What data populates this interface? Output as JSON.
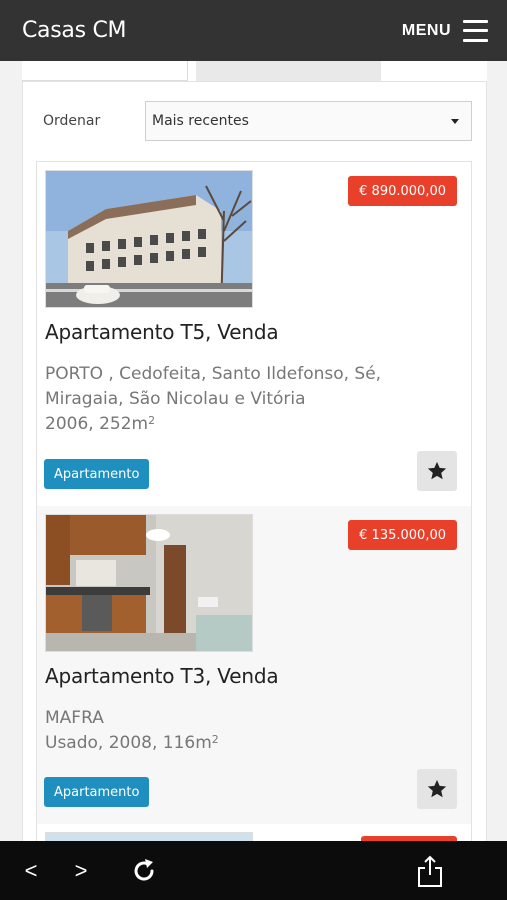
{
  "header": {
    "title": "Casas CM",
    "menu_label": "MENU",
    "menu_icon": "hamburger-icon"
  },
  "sort": {
    "label": "Ordenar",
    "selected": "Mais recentes"
  },
  "listings": [
    {
      "price": "€ 890.000,00",
      "title": "Apartamento T5, Venda",
      "location": "PORTO , Cedofeita, Santo Ildefonso, Sé, Miragaia, São Nicolau e Vitória",
      "year_area": "2006, 252m",
      "area_unit_sup": "2",
      "tag": "Apartamento"
    },
    {
      "price": "€ 135.000,00",
      "title": "Apartamento T3, Venda",
      "location": "MAFRA",
      "year_area": "Usado, 2008, 116m",
      "area_unit_sup": "2",
      "tag": "Apartamento"
    }
  ],
  "colors": {
    "price_badge": "#e8402a",
    "tag": "#1f8fbf",
    "header": "#333333",
    "browser_bar": "#0c0c0c"
  },
  "browser": {
    "back": "<",
    "forward": ">",
    "reload_icon": "reload-icon",
    "share_icon": "share-icon"
  }
}
